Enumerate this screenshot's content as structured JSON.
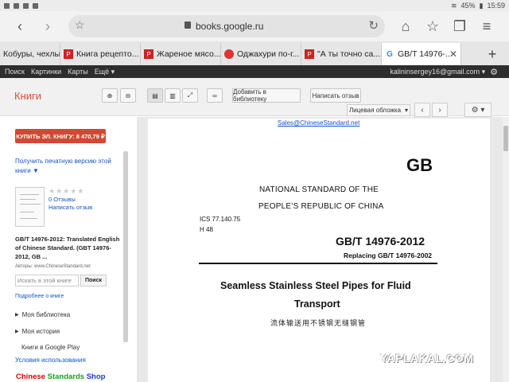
{
  "status_bar": {
    "left_icons": [
      "app-icon",
      "app-icon",
      "app-icon",
      "app-icon"
    ],
    "battery": "45%",
    "time": "15:59"
  },
  "browser": {
    "url": "books.google.ru",
    "tabs": [
      {
        "label": "Кобуры, чехлы...",
        "icon": "shop-icon"
      },
      {
        "label": "Книга рецепто...",
        "icon": "pikabu-icon"
      },
      {
        "label": "Жареное мясо...",
        "icon": "pikabu-icon"
      },
      {
        "label": "Оджахури по-г...",
        "icon": "red-circle-icon"
      },
      {
        "label": "\"А ты точно са...",
        "icon": "pikabu-icon"
      },
      {
        "label": "GB/T 14976-...",
        "icon": "google-icon",
        "active": true
      }
    ],
    "new_tab": "+"
  },
  "gbar": {
    "items": [
      "Поиск",
      "Картинки",
      "Карты",
      "Ещё ▾"
    ],
    "account": "kalininsergey16@gmail.com ▾"
  },
  "books": {
    "title": "Книги",
    "add_library": "Добавить в библиотеку",
    "write_review": "Написать отзыв",
    "cover_select": "Лицевая обложка",
    "buy_button": "КУПИТЬ ЭЛ. КНИГУ: 8 470,79 ₽",
    "print_version": "Получить печатную версию этой книги ▼",
    "rating_stars": "★★★★★",
    "reviews_count": "0 Отзывы",
    "write_review_link": "Написать отзыв",
    "book_title": "GB/T 14976-2012: Translated English of Chinese Standard. (GBT 14976-2012, GB ...",
    "authors": "Авторы: www.ChineseStandard.net",
    "search_placeholder": "Искать в этой книге",
    "search_button": "Поиск",
    "more_link": "Подробнее о книге",
    "my_library": "Моя библиотека",
    "my_history": "Моя история",
    "google_play": "Книги в Google Play",
    "terms": "Условия использования",
    "shop_logo": [
      "Chinese ",
      "Standards ",
      "Shop"
    ]
  },
  "document": {
    "email": "Sales@ChineseStandard.net",
    "gb": "GB",
    "national_1": "NATIONAL STANDARD OF THE",
    "national_2": "PEOPLE’S REPUBLIC OF CHINA",
    "ics": "ICS 77.140.75",
    "h48": "H 48",
    "code": "GB/T 14976-2012",
    "replacing": "Replacing  GB/T  14976-2002",
    "title_1": "Seamless Stainless Steel Pipes for Fluid",
    "title_2": "Transport",
    "chinese_title": "流体输送用不锈钢无缝钢管"
  },
  "watermark": "YAPLAKAL.COM",
  "colors": {
    "accent": "#dd4b39",
    "buy": "#d14836",
    "link": "#1155cc"
  }
}
